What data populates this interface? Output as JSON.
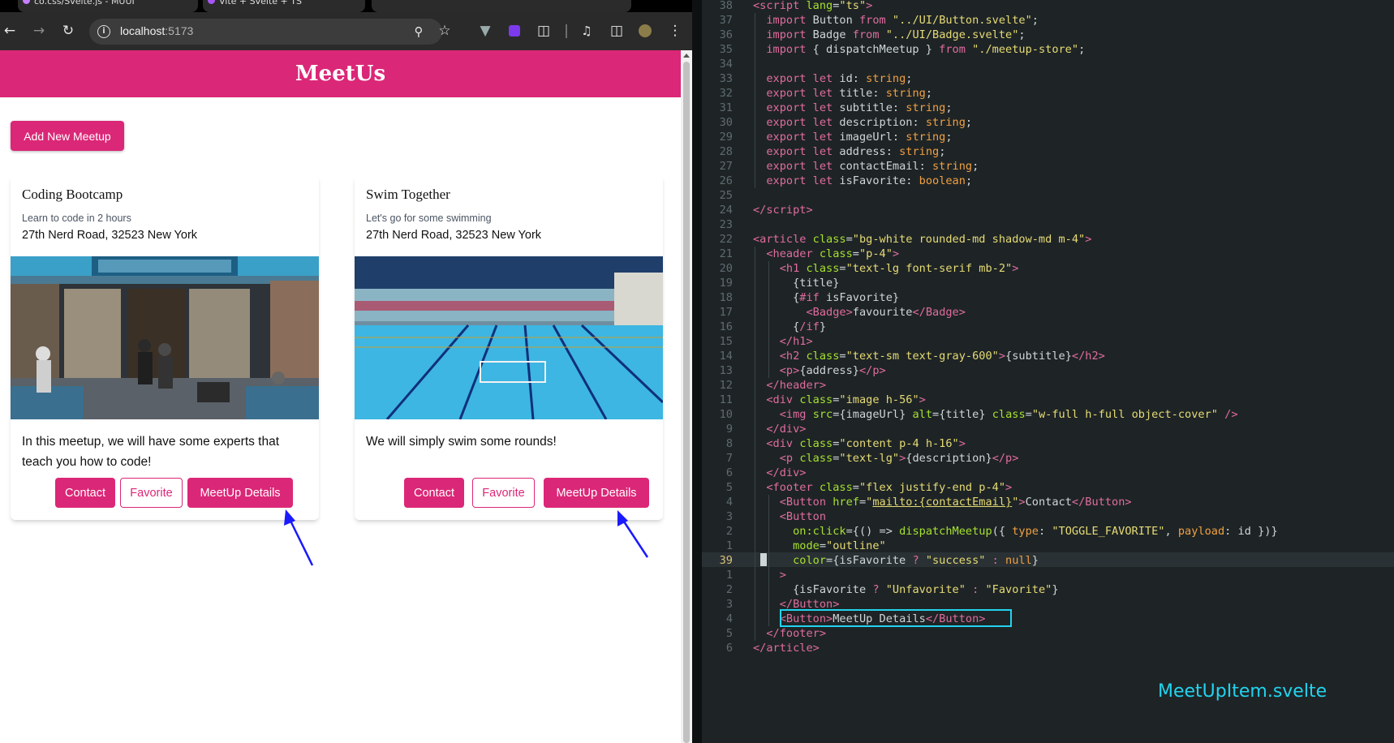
{
  "browser": {
    "tabs": [
      {
        "label": "co.css/Svelte.js - MUUI"
      },
      {
        "label": "Vite + Svelte + TS"
      }
    ],
    "url_host": "localhost",
    "url_port": ":5173",
    "toolbar_icons": [
      "back-icon",
      "forward-icon",
      "reload-icon",
      "info-icon",
      "zoom-icon",
      "star-icon",
      "vue-devtools-icon",
      "extension-icon",
      "puzzle-icon",
      "media-icon",
      "sidebar-icon",
      "profile-icon",
      "menu-icon"
    ]
  },
  "app": {
    "title": "MeetUs",
    "add_button": "Add New Meetup",
    "meetups": [
      {
        "title": "Coding Bootcamp",
        "subtitle": "Learn to code in 2 hours",
        "address": "27th Nerd Road, 32523 New York",
        "description": "In this meetup, we will have some experts that teach you how to code!",
        "image": "cafe-storefront",
        "buttons": {
          "contact": "Contact",
          "favorite": "Favorite",
          "details": "MeetUp Details"
        }
      },
      {
        "title": "Swim Together",
        "subtitle": "Let's go for some swimming",
        "address": "27th Nerd Road, 32523 New York",
        "description": "We will simply swim some rounds!",
        "image": "indoor-swimming-pool",
        "buttons": {
          "contact": "Contact",
          "favorite": "Favorite",
          "details": "MeetUp Details"
        }
      }
    ],
    "annotation_color": "#1a1aff",
    "accent": "#db2777"
  },
  "editor": {
    "filename": "MeetUpItem.svelte",
    "highlight_color": "#22d3ee",
    "current_line_number": "39",
    "line_numbers": [
      "38",
      "37",
      "36",
      "35",
      "34",
      "33",
      "32",
      "31",
      "30",
      "29",
      "28",
      "27",
      "26",
      "25",
      "24",
      "23",
      "22",
      "21",
      "20",
      "19",
      "18",
      "17",
      "16",
      "15",
      "14",
      "13",
      "12",
      "11",
      "10",
      "9",
      "8",
      "7",
      "6",
      "5",
      "4",
      "3",
      "2",
      "1",
      "39",
      "1",
      "2",
      "3",
      "4",
      "5",
      "6"
    ]
  }
}
